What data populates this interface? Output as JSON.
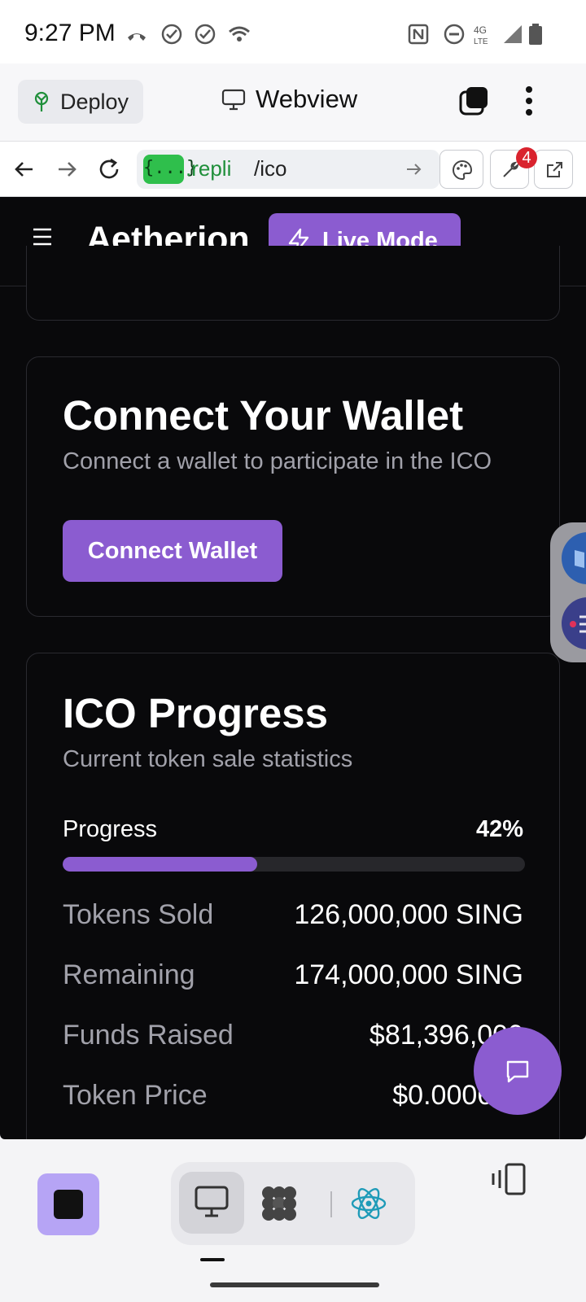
{
  "status_bar": {
    "time": "9:27 PM"
  },
  "replit_bar": {
    "deploy_label": "Deploy",
    "title": "Webview"
  },
  "url_bar": {
    "chip": "{...}",
    "domain": ".repli",
    "path": "/ico",
    "notification_count": "4"
  },
  "app": {
    "brand": "Aetherion",
    "live_mode_label": "Live Mode",
    "wallet_card": {
      "title": "Connect Your Wallet",
      "subtitle": "Connect a wallet to participate in the ICO",
      "button_label": "Connect Wallet"
    },
    "progress_card": {
      "title": "ICO Progress",
      "subtitle": "Current token sale statistics",
      "progress_label": "Progress",
      "progress_percent_text": "42%",
      "progress_fraction": 0.42,
      "rows": [
        {
          "label": "Tokens Sold",
          "value": "126,000,000 SING"
        },
        {
          "label": "Remaining",
          "value": "174,000,000 SING"
        },
        {
          "label": "Funds Raised",
          "value": "$81,396,000"
        },
        {
          "label": "Token Price",
          "value": "$0.000646"
        }
      ]
    }
  },
  "colors": {
    "accent": "#8b5cd0",
    "background": "#09090b",
    "muted_text": "#a1a1aa"
  }
}
